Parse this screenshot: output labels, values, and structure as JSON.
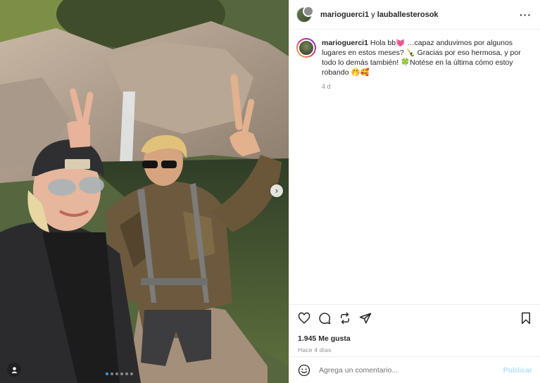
{
  "header": {
    "user1": "marioguerci1",
    "joiner": " y ",
    "user2": "lauballesterosok",
    "more_icon": "more-horizontal-icon"
  },
  "caption": {
    "username": "marioguerci1",
    "text": " Hola bb💓 …capaz anduvimos por algunos lugares en estos meses? 🍾 Gracias por eso hermosa, y por todo lo demás también! 🍀Notése en la última cómo estoy robando 🤭🥰",
    "age": "4 d"
  },
  "actions": {
    "icons": [
      "heart-icon",
      "comment-icon",
      "repost-icon",
      "share-icon",
      "bookmark-icon"
    ],
    "likes": "1.945 Me gusta",
    "ago": "Hace 4 días"
  },
  "comment": {
    "placeholder": "Agrega un comentario...",
    "publish": "Publicar",
    "emoji_icon": "emoji-icon"
  },
  "media": {
    "next_icon": "chevron-right-icon",
    "tag_icon": "user-tag-icon",
    "carousel_total": 6,
    "carousel_active": 1
  }
}
